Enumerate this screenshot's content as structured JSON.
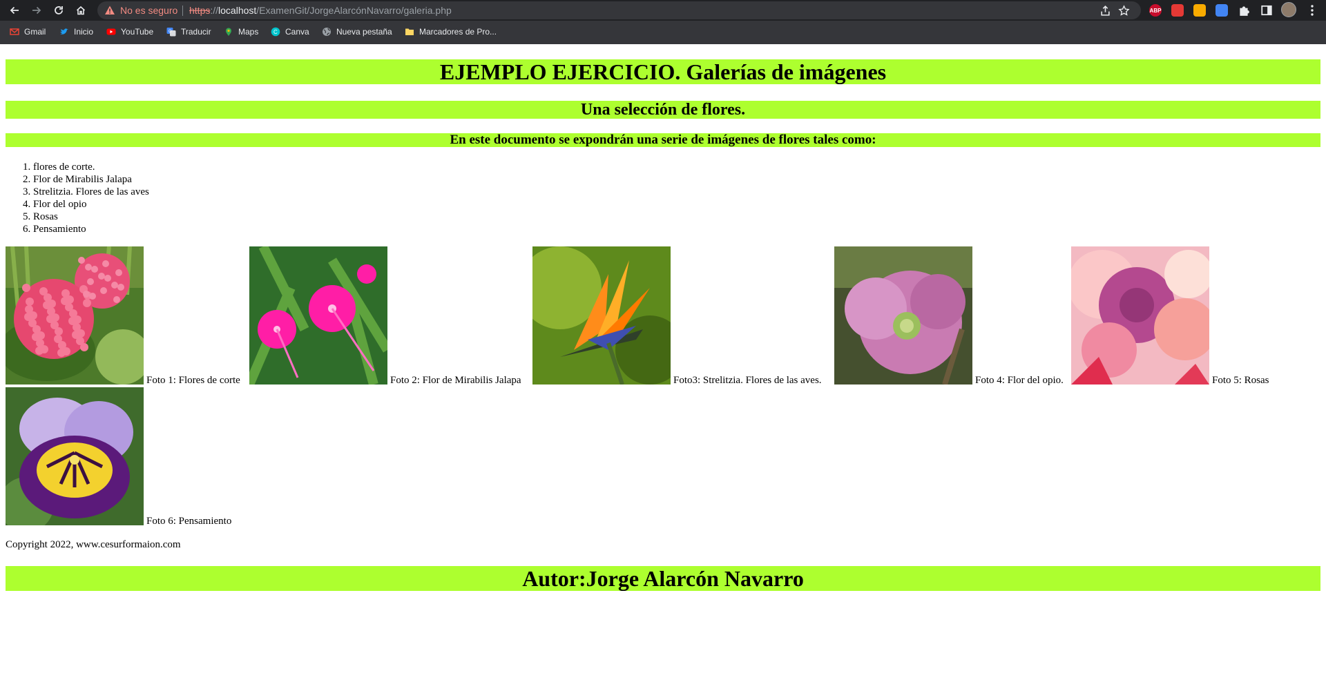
{
  "browser": {
    "security_label": "No es seguro",
    "url_scheme": "https",
    "url_separator": "://",
    "url_host": "localhost",
    "url_path": "/ExamenGit/JorgeAlarcónNavarro/galeria.php",
    "bookmarks": [
      {
        "label": "Gmail",
        "icon": "gmail-icon",
        "color": "#ea4335"
      },
      {
        "label": "Inicio",
        "icon": "twitter-icon",
        "color": "#1d9bf0"
      },
      {
        "label": "YouTube",
        "icon": "youtube-icon",
        "color": "#ff0000"
      },
      {
        "label": "Traducir",
        "icon": "translate-icon",
        "color": "#4285f4"
      },
      {
        "label": "Maps",
        "icon": "maps-icon",
        "color": "#34a853"
      },
      {
        "label": "Canva",
        "icon": "canva-icon",
        "color": "#00c4cc"
      },
      {
        "label": "Nueva pestaña",
        "icon": "globe-icon",
        "color": "#9aa0a6"
      },
      {
        "label": "Marcadores de Pro...",
        "icon": "folder-icon",
        "color": "#fdd663"
      }
    ],
    "extensions": [
      {
        "name": "adblock-extension-icon",
        "text": "ABP",
        "color": "#c70d2c"
      },
      {
        "name": "extension-red-icon",
        "text": "",
        "color": "#e53935"
      },
      {
        "name": "extension-yellow-icon",
        "text": "",
        "color": "#f9ab00"
      },
      {
        "name": "extension-color-icon",
        "text": "",
        "color": "#4285f4"
      }
    ]
  },
  "page": {
    "title": "EJEMPLO EJERCICIO. Galerías de imágenes",
    "subtitle": "Una selección de flores.",
    "intro": "En este documento se expondrán una serie de imágenes de flores tales como:",
    "list": [
      "flores de corte.",
      "Flor de Mirabilis Jalapa",
      "Strelitzia. Flores de las aves",
      "Flor del opio",
      "Rosas",
      "Pensamiento"
    ],
    "photos": [
      {
        "caption": "Foto 1: Flores de corte",
        "subject": "hydrangea"
      },
      {
        "caption": "Foto 2: Flor de Mirabilis Jalapa",
        "subject": "mirabilis"
      },
      {
        "caption": "Foto3: Strelitzia. Flores de las aves.",
        "subject": "strelitzia"
      },
      {
        "caption": "Foto 4: Flor del opio.",
        "subject": "poppy"
      },
      {
        "caption": "Foto 5: Rosas",
        "subject": "roses"
      },
      {
        "caption": "Foto 6: Pensamiento",
        "subject": "pansy"
      }
    ],
    "copyright": "Copyright 2022, www.cesurformaion.com",
    "author": "Autor:Jorge Alarcón Navarro",
    "accent_color": "#adff2f"
  }
}
